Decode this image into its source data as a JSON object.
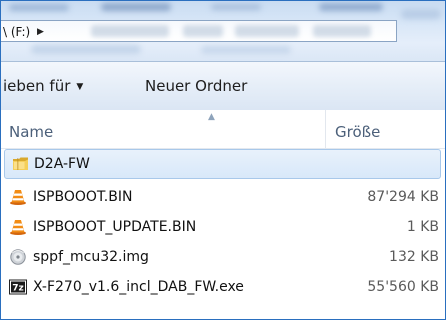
{
  "address_bar": {
    "path": "\\ (F:)",
    "arrow": "▶"
  },
  "toolbar": {
    "share_label": "ieben für",
    "share_caret": "▼",
    "new_folder_label": "Neuer Ordner"
  },
  "columns": {
    "name": "Name",
    "size": "Größe"
  },
  "files": [
    {
      "name": "D2A-FW",
      "size": "",
      "icon": "folder-icon",
      "selected": true
    },
    {
      "name": "ISPBOOOT.BIN",
      "size": "87'294 KB",
      "icon": "vlc-cone-icon",
      "selected": false
    },
    {
      "name": "ISPBOOOT_UPDATE.BIN",
      "size": "1 KB",
      "icon": "vlc-cone-icon",
      "selected": false
    },
    {
      "name": "sppf_mcu32.img",
      "size": "132 KB",
      "icon": "disk-image-icon",
      "selected": false
    },
    {
      "name": "X-F270_v1.6_incl_DAB_FW.exe",
      "size": "55'560 KB",
      "icon": "7zip-icon",
      "selected": false
    }
  ],
  "colors": {
    "selection_fill": "#d8e8f9",
    "selection_border": "#a8c8ea",
    "header_text": "#4c607a",
    "window_border": "#2a6fbf"
  }
}
